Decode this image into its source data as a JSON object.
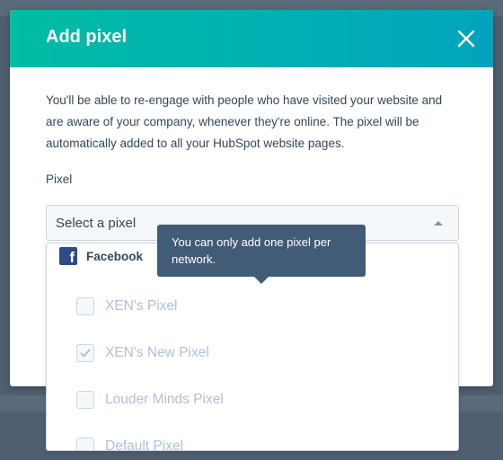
{
  "modal": {
    "title": "Add pixel",
    "intro": "You'll be able to re-engage with people who have visited your website and are aware of your company, whenever they're online. The pixel will be automatically added to all your HubSpot website pages.",
    "field_label": "Pixel",
    "select_placeholder": "Select a pixel"
  },
  "dropdown": {
    "group_label": "Facebook",
    "options": [
      {
        "label": "XEN's Pixel",
        "checked": false
      },
      {
        "label": "XEN's New Pixel",
        "checked": true
      },
      {
        "label": "Louder Minds Pixel",
        "checked": false
      },
      {
        "label": "Default Pixel",
        "checked": false
      }
    ]
  },
  "tooltip": {
    "text": "You can only add one pixel per network."
  },
  "colors": {
    "header_start": "#00bda5",
    "header_end": "#00a4bd",
    "tooltip_bg": "#425b76",
    "text": "#33475b",
    "disabled_text": "#b0c1d4"
  }
}
